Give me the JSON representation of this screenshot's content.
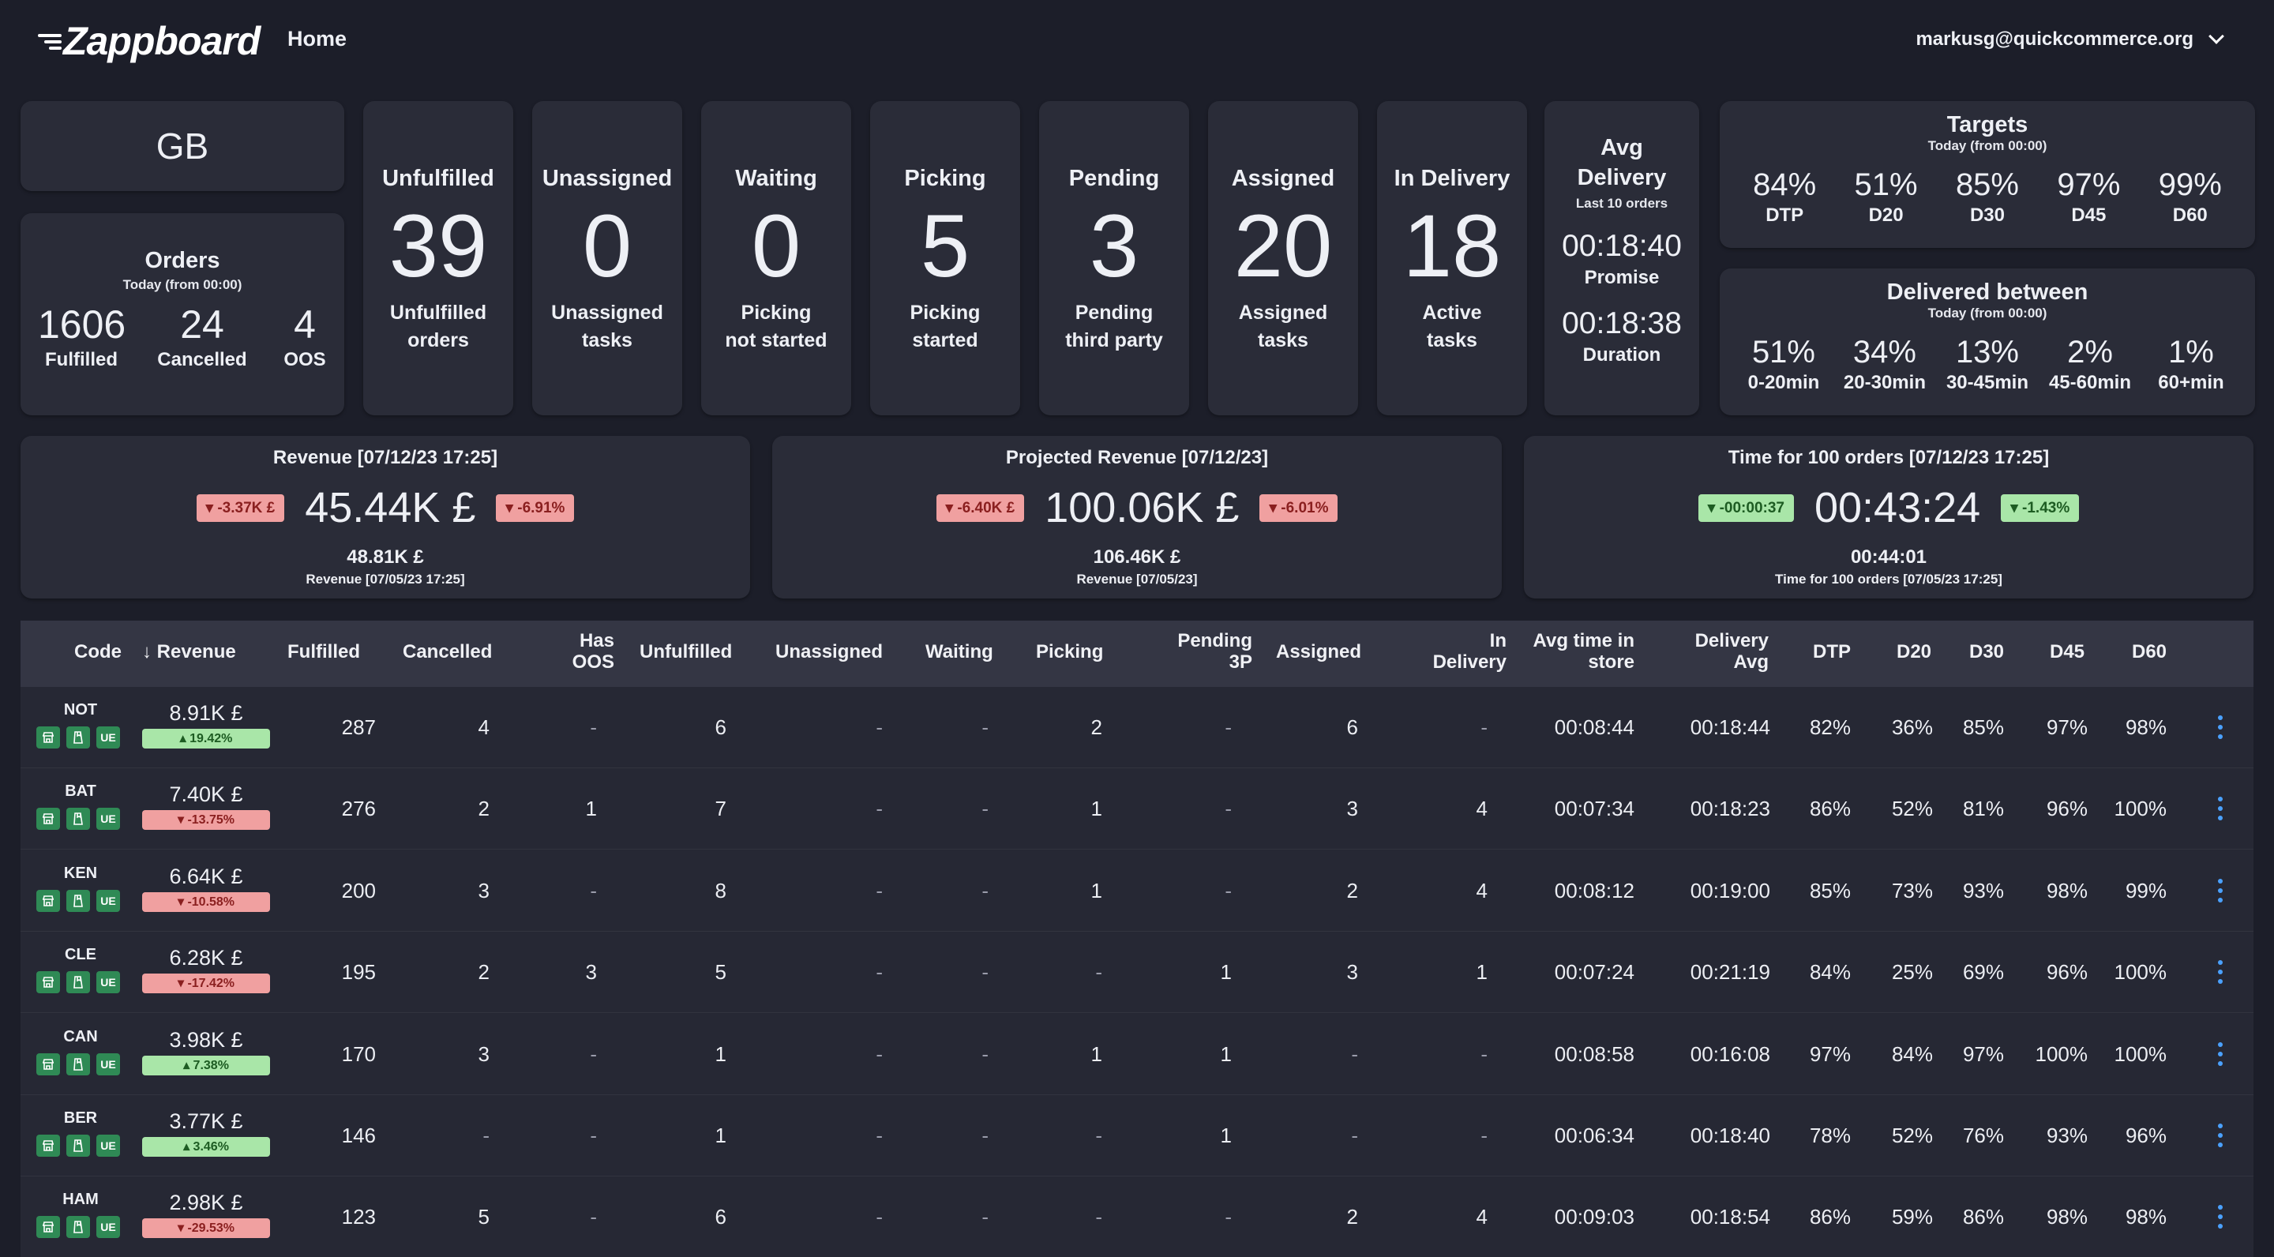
{
  "app": {
    "name": "Zappboard",
    "nav_home": "Home",
    "user_email": "markusg@quickcommerce.org"
  },
  "region": "GB",
  "orders": {
    "title": "Orders",
    "subtitle": "Today (from 00:00)",
    "fulfilled": {
      "value": "1606",
      "label": "Fulfilled"
    },
    "cancelled": {
      "value": "24",
      "label": "Cancelled"
    },
    "oos": {
      "value": "4",
      "label": "OOS"
    }
  },
  "kpis": [
    {
      "title": "Unfulfilled",
      "value": "39",
      "line1": "Unfulfilled",
      "line2": "orders"
    },
    {
      "title": "Unassigned",
      "value": "0",
      "line1": "Unassigned",
      "line2": "tasks"
    },
    {
      "title": "Waiting",
      "value": "0",
      "line1": "Picking",
      "line2": "not started"
    },
    {
      "title": "Picking",
      "value": "5",
      "line1": "Picking",
      "line2": "started"
    },
    {
      "title": "Pending",
      "value": "3",
      "line1": "Pending",
      "line2": "third party"
    },
    {
      "title": "Assigned",
      "value": "20",
      "line1": "Assigned",
      "line2": "tasks"
    },
    {
      "title": "In Delivery",
      "value": "18",
      "line1": "Active",
      "line2": "tasks"
    }
  ],
  "avg_delivery": {
    "title_line1": "Avg",
    "title_line2": "Delivery",
    "subtitle": "Last 10 orders",
    "promise": "00:18:40",
    "promise_label": "Promise",
    "duration": "00:18:38",
    "duration_label": "Duration"
  },
  "targets": {
    "title": "Targets",
    "subtitle": "Today (from 00:00)",
    "items": [
      {
        "value": "84%",
        "label": "DTP"
      },
      {
        "value": "51%",
        "label": "D20"
      },
      {
        "value": "85%",
        "label": "D30"
      },
      {
        "value": "97%",
        "label": "D45"
      },
      {
        "value": "99%",
        "label": "D60"
      }
    ]
  },
  "delivered_between": {
    "title": "Delivered between",
    "subtitle": "Today (from 00:00)",
    "items": [
      {
        "value": "51%",
        "label": "0-20min"
      },
      {
        "value": "34%",
        "label": "20-30min"
      },
      {
        "value": "13%",
        "label": "30-45min"
      },
      {
        "value": "2%",
        "label": "45-60min"
      },
      {
        "value": "1%",
        "label": "60+min"
      }
    ]
  },
  "revenue_cards": [
    {
      "title": "Revenue [07/12/23 17:25]",
      "left_badge": "-3.37K £",
      "left_color": "red",
      "value": "45.44K £",
      "right_badge": "-6.91%",
      "right_color": "red",
      "prev_value": "48.81K £",
      "prev_label": "Revenue [07/05/23 17:25]"
    },
    {
      "title": "Projected Revenue [07/12/23]",
      "left_badge": "-6.40K £",
      "left_color": "red",
      "value": "100.06K £",
      "right_badge": "-6.01%",
      "right_color": "red",
      "prev_value": "106.46K £",
      "prev_label": "Revenue [07/05/23]"
    },
    {
      "title": "Time for 100 orders [07/12/23 17:25]",
      "left_badge": "-00:00:37",
      "left_color": "green",
      "value": "00:43:24",
      "right_badge": "-1.43%",
      "right_color": "green",
      "prev_value": "00:44:01",
      "prev_label": "Time for 100 orders [07/05/23 17:25]"
    }
  ],
  "table": {
    "headers": {
      "code": "Code",
      "revenue": "Revenue",
      "fulfilled": "Fulfilled",
      "cancelled": "Cancelled",
      "has_oos_1": "Has",
      "has_oos_2": "OOS",
      "unfulfilled": "Unfulfilled",
      "unassigned": "Unassigned",
      "waiting": "Waiting",
      "picking": "Picking",
      "pending_1": "Pending",
      "pending_2": "3P",
      "assigned": "Assigned",
      "in_delivery_1": "In",
      "in_delivery_2": "Delivery",
      "avg_store_1": "Avg time in",
      "avg_store_2": "store",
      "delivery_avg_1": "Delivery",
      "delivery_avg_2": "Avg",
      "dtp": "DTP",
      "d20": "D20",
      "d30": "D30",
      "d45": "D45",
      "d60": "D60"
    },
    "icon_labels": {
      "ue": "UE"
    },
    "rows": [
      {
        "code": "NOT",
        "revenue": "8.91K £",
        "change": "19.42%",
        "trend": "up",
        "fulfilled": "287",
        "cancelled": "4",
        "has_oos": "-",
        "unfulfilled": "6",
        "unassigned": "-",
        "waiting": "-",
        "picking": "2",
        "pending": "-",
        "assigned": "6",
        "in_delivery": "-",
        "avg_store": "00:08:44",
        "delivery_avg": "00:18:44",
        "dtp": "82%",
        "d20": "36%",
        "d30": "85%",
        "d45": "97%",
        "d60": "98%"
      },
      {
        "code": "BAT",
        "revenue": "7.40K £",
        "change": "-13.75%",
        "trend": "down",
        "fulfilled": "276",
        "cancelled": "2",
        "has_oos": "1",
        "unfulfilled": "7",
        "unassigned": "-",
        "waiting": "-",
        "picking": "1",
        "pending": "-",
        "assigned": "3",
        "in_delivery": "4",
        "avg_store": "00:07:34",
        "delivery_avg": "00:18:23",
        "dtp": "86%",
        "d20": "52%",
        "d30": "81%",
        "d45": "96%",
        "d60": "100%"
      },
      {
        "code": "KEN",
        "revenue": "6.64K £",
        "change": "-10.58%",
        "trend": "down",
        "fulfilled": "200",
        "cancelled": "3",
        "has_oos": "-",
        "unfulfilled": "8",
        "unassigned": "-",
        "waiting": "-",
        "picking": "1",
        "pending": "-",
        "assigned": "2",
        "in_delivery": "4",
        "avg_store": "00:08:12",
        "delivery_avg": "00:19:00",
        "dtp": "85%",
        "d20": "73%",
        "d30": "93%",
        "d45": "98%",
        "d60": "99%"
      },
      {
        "code": "CLE",
        "revenue": "6.28K £",
        "change": "-17.42%",
        "trend": "down",
        "fulfilled": "195",
        "cancelled": "2",
        "has_oos": "3",
        "unfulfilled": "5",
        "unassigned": "-",
        "waiting": "-",
        "picking": "-",
        "pending": "1",
        "assigned": "3",
        "in_delivery": "1",
        "avg_store": "00:07:24",
        "delivery_avg": "00:21:19",
        "dtp": "84%",
        "d20": "25%",
        "d30": "69%",
        "d45": "96%",
        "d60": "100%"
      },
      {
        "code": "CAN",
        "revenue": "3.98K £",
        "change": "7.38%",
        "trend": "up",
        "fulfilled": "170",
        "cancelled": "3",
        "has_oos": "-",
        "unfulfilled": "1",
        "unassigned": "-",
        "waiting": "-",
        "picking": "1",
        "pending": "1",
        "assigned": "-",
        "in_delivery": "-",
        "avg_store": "00:08:58",
        "delivery_avg": "00:16:08",
        "dtp": "97%",
        "d20": "84%",
        "d30": "97%",
        "d45": "100%",
        "d60": "100%"
      },
      {
        "code": "BER",
        "revenue": "3.77K £",
        "change": "3.46%",
        "trend": "up",
        "fulfilled": "146",
        "cancelled": "-",
        "has_oos": "-",
        "unfulfilled": "1",
        "unassigned": "-",
        "waiting": "-",
        "picking": "-",
        "pending": "1",
        "assigned": "-",
        "in_delivery": "-",
        "avg_store": "00:06:34",
        "delivery_avg": "00:18:40",
        "dtp": "78%",
        "d20": "52%",
        "d30": "76%",
        "d45": "93%",
        "d60": "96%"
      },
      {
        "code": "HAM",
        "revenue": "2.98K £",
        "change": "-29.53%",
        "trend": "down",
        "fulfilled": "123",
        "cancelled": "5",
        "has_oos": "-",
        "unfulfilled": "6",
        "unassigned": "-",
        "waiting": "-",
        "picking": "-",
        "pending": "-",
        "assigned": "2",
        "in_delivery": "4",
        "avg_store": "00:09:03",
        "delivery_avg": "00:18:54",
        "dtp": "86%",
        "d20": "59%",
        "d30": "86%",
        "d45": "98%",
        "d60": "98%"
      }
    ]
  }
}
